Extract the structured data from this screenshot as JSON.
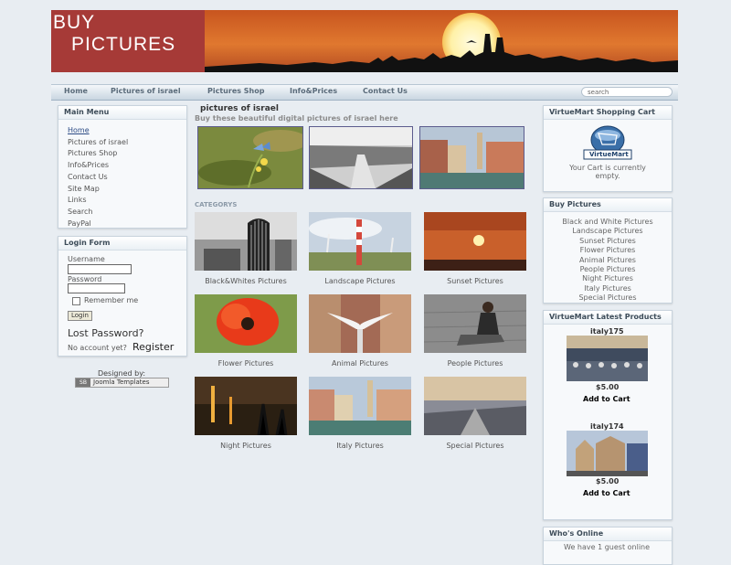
{
  "logo": {
    "line1": "BUY",
    "line2": "PICTURES"
  },
  "nav": {
    "items": [
      "Home",
      "Pictures of israel",
      "Pictures Shop",
      "Info&Prices",
      "Contact Us"
    ],
    "search_placeholder": "search"
  },
  "main_menu": {
    "title": "Main Menu",
    "items": [
      "Home",
      "Pictures of israel",
      "Pictures Shop",
      "Info&Prices",
      "Contact Us",
      "Site Map",
      "Links",
      "Search",
      "PayPal"
    ]
  },
  "login": {
    "title": "Login Form",
    "username_label": "Username",
    "password_label": "Password",
    "remember_label": "Remember me",
    "login_button": "Login",
    "lost_password": "Lost Password?",
    "no_account": "No account yet?",
    "register": "Register"
  },
  "credit": {
    "designed_by": "Designed by:",
    "badge": "Joomla Templates"
  },
  "content": {
    "title": "pictures of israel",
    "subtitle": "Buy these beautiful digital pictures of israel here",
    "categories_heading": "CATEGORYS",
    "categories": [
      "Black&Whites Pictures",
      "Landscape Pictures",
      "Sunset Pictures",
      "Flower Pictures",
      "Animal Pictures",
      "People Pictures",
      "Night Pictures",
      "Italy Pictures",
      "Special Pictures"
    ]
  },
  "cart": {
    "title": "VirtueMart Shopping Cart",
    "logo_text": "VirtueMart",
    "empty_text": "Your Cart is currently empty."
  },
  "buy_pictures": {
    "title": "Buy Pictures",
    "items": [
      "Black and White Pictures",
      "Landscape Pictures",
      "Sunset Pictures",
      "Flower Pictures",
      "Animal Pictures",
      "People Pictures",
      "Night Pictures",
      "Italy Pictures",
      "Special Pictures"
    ]
  },
  "latest": {
    "title": "VirtueMart Latest Products",
    "products": [
      {
        "name": "italy175",
        "price": "$5.00",
        "add": "Add to Cart"
      },
      {
        "name": "italy174",
        "price": "$5.00",
        "add": "Add to Cart"
      }
    ]
  },
  "whos_online": {
    "title": "Who's Online",
    "text": "We have 1 guest online"
  },
  "colors": {
    "logo_bg": "#a63a37",
    "sunset": "#d9692e",
    "link": "#2b4a84"
  }
}
